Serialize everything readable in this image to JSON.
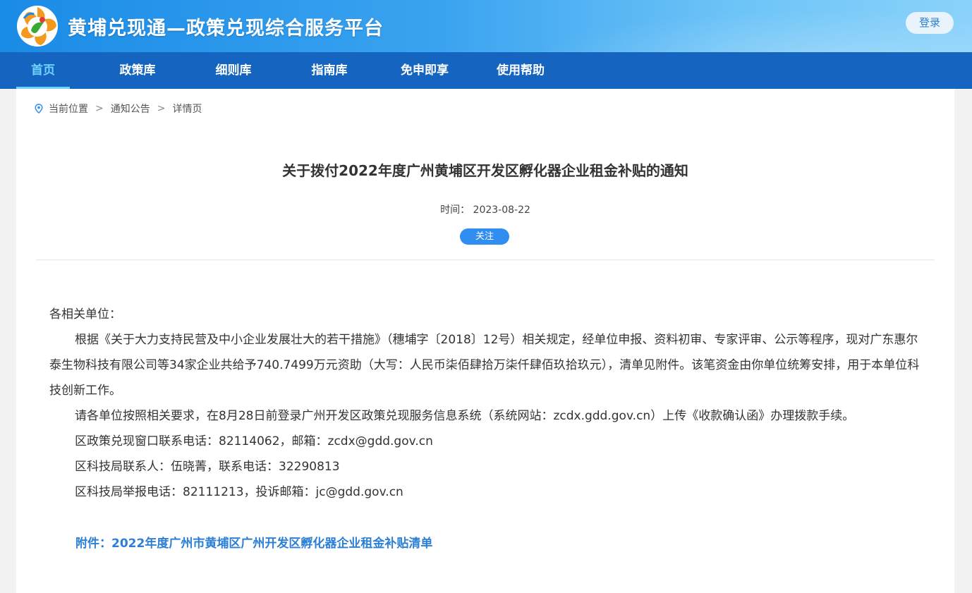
{
  "header": {
    "site_title": "黄埔兑现通—政策兑现综合服务平台",
    "login_label": "登录",
    "logo_icon": "gdd-flower-logo-icon"
  },
  "nav": {
    "items": [
      {
        "label": "首页",
        "active": true
      },
      {
        "label": "政策库",
        "active": false
      },
      {
        "label": "细则库",
        "active": false
      },
      {
        "label": "指南库",
        "active": false
      },
      {
        "label": "免申即享",
        "active": false
      },
      {
        "label": "使用帮助",
        "active": false
      }
    ]
  },
  "breadcrumb": {
    "icon": "location-pin-icon",
    "items": [
      "当前位置",
      "通知公告",
      "详情页"
    ],
    "separator": ">"
  },
  "article": {
    "title": "关于拨付2022年度广州黄埔区开发区孵化器企业租金补贴的通知",
    "time_label": "时间：",
    "time_value": "2023-08-22",
    "follow_label": "关注",
    "salutation": "各相关单位：",
    "paragraphs": [
      "根据《关于大力支持民营及中小企业发展壮大的若干措施》（穗埔字〔2018〕12号）相关规定，经单位申报、资料初审、专家评审、公示等程序，现对广东惠尔泰生物科技有限公司等34家企业共给予740.7499万元资助（大写：人民币柒佰肆拾万柒仟肆佰玖拾玖元），清单见附件。该笔资金由你单位统筹安排，用于本单位科技创新工作。",
      "请各单位按照相关要求，在8月28日前登录广州开发区政策兑现服务信息系统（系统网站：zcdx.gdd.gov.cn）上传《收款确认函》办理拨款手续。",
      "区政策兑现窗口联系电话：82114062，邮箱：zcdx@gdd.gov.cn",
      "区科技局联系人：伍晓菁，联系电话：32290813",
      "区科技局举报电话：82111213，投诉邮箱：jc@gdd.gov.cn"
    ],
    "attachment": "附件：2022年度广州市黄埔区广州开发区孵化器企业租金补贴清单"
  },
  "colors": {
    "nav_bg": "#1565c0",
    "nav_active": "#6fd3ff",
    "accent": "#2f8ef0",
    "link": "#2b7fd6"
  }
}
